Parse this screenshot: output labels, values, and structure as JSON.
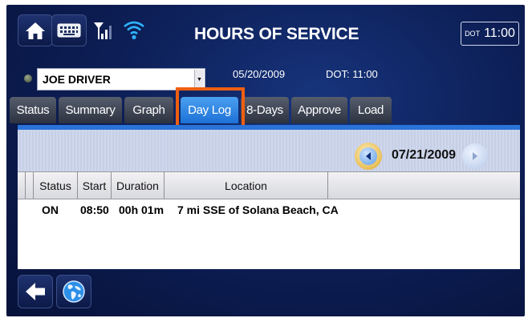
{
  "header": {
    "title": "HOURS OF SERVICE",
    "dot_label": "DOT",
    "clock": "11:00"
  },
  "driver_bar": {
    "driver_name": "JOE DRIVER",
    "date": "05/20/2009",
    "dot_status": "DOT: 11:00"
  },
  "tabs": [
    "Status",
    "Summary",
    "Graph",
    "Day Log",
    "8-Days",
    "Approve",
    "Load"
  ],
  "active_tab": "Day Log",
  "highlight_color": "#ee5f11",
  "accent_color": "#2a73d8",
  "log": {
    "date": "07/21/2009",
    "columns": [
      "Status",
      "Start",
      "Duration",
      "Location"
    ],
    "rows": [
      {
        "status": "ON",
        "start": "08:50",
        "duration": "00h 01m",
        "location": "7 mi SSE of Solana Beach, CA"
      }
    ]
  },
  "icons": [
    "home-icon",
    "keyboard-icon",
    "signal-icon",
    "wifi-icon",
    "back-arrow-icon",
    "globe-icon"
  ]
}
